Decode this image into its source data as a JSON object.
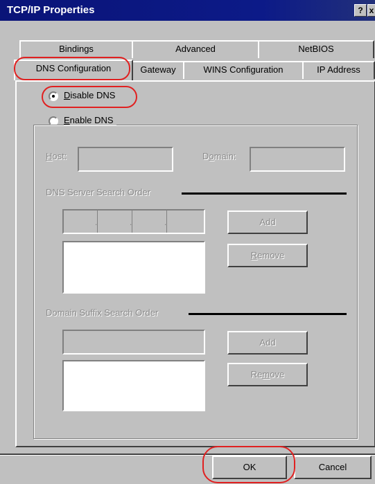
{
  "window": {
    "title": "TCP/IP Properties",
    "help_glyph": "?",
    "close_glyph": "x"
  },
  "tabs": {
    "row1": [
      "Bindings",
      "Advanced",
      "NetBIOS"
    ],
    "row2": [
      "DNS Configuration",
      "Gateway",
      "WINS Configuration",
      "IP Address"
    ],
    "active": "DNS Configuration"
  },
  "dns": {
    "disable_label_pre": "D",
    "disable_label_rest": "isable DNS",
    "enable_label_pre": "E",
    "enable_label_rest": "nable DNS",
    "selected": "Disable DNS",
    "host_label_pre": "H",
    "host_label_rest": "ost:",
    "host_value": "",
    "domain_label_pre": "D",
    "domain_label_mid": "o",
    "domain_label_rest": "main:",
    "domain_value": "",
    "server_order_title": "DNS Server Search Order",
    "ip_separators": [
      ".",
      ".",
      "."
    ],
    "add_label": "Add",
    "remove_label_pre": "R",
    "remove_label_rest": "emove",
    "suffix_order_title": "Domain Suffix Search Order",
    "add2_label": "Add",
    "remove2_label_pre": "Re",
    "remove2_label_mid": "m",
    "remove2_label_rest": "ove"
  },
  "footer": {
    "ok_label": "OK",
    "cancel_label": "Cancel"
  },
  "colors": {
    "titlebar": "#0c1a88",
    "dialog_face": "#c0c0c0",
    "highlight_oval": "#e02020"
  }
}
